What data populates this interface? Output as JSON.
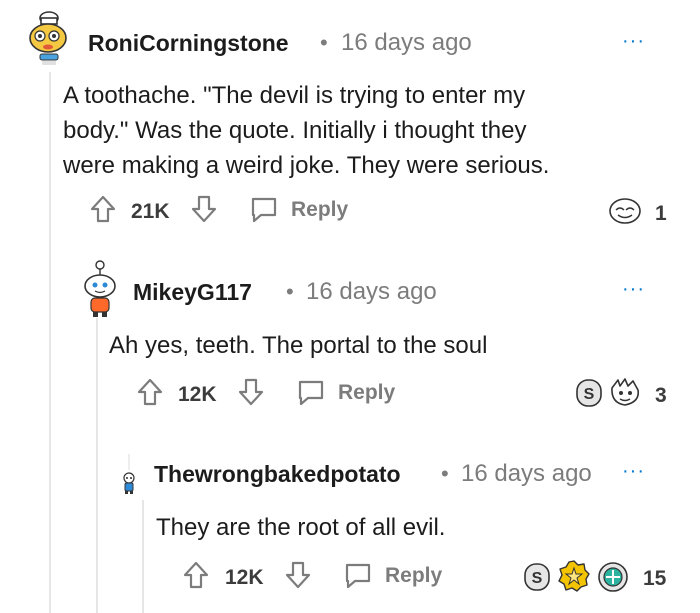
{
  "comments": [
    {
      "username": "RoniCorningstone",
      "separator": "•",
      "time": "16 days ago",
      "more": "···",
      "body_lines": [
        "A toothache. \"The devil is trying to enter my",
        "body.\" Was the quote. Initially i thought they",
        "were making a weird joke. They were serious."
      ],
      "votes": "21K",
      "reply_label": "Reply",
      "award_count": "1"
    },
    {
      "username": "MikeyG117",
      "separator": "•",
      "time": "16 days ago",
      "more": "···",
      "body_lines": [
        "Ah yes, teeth. The portal to the soul"
      ],
      "votes": "12K",
      "reply_label": "Reply",
      "award_count": "3"
    },
    {
      "username": "Thewrongbakedpotato",
      "separator": "•",
      "time": "16 days ago",
      "more": "···",
      "body_lines": [
        "They are the root of all evil."
      ],
      "votes": "12K",
      "reply_label": "Reply",
      "award_count": "15"
    }
  ],
  "colors": {
    "link": "#0079d3",
    "meta": "#7c7c7c",
    "thread": "#e6e6e6",
    "award_gold": "#f5c400",
    "award_teal": "#2bb3a0"
  },
  "icons": [
    "upvote-icon",
    "downvote-icon",
    "reply-bubble-icon",
    "award-icon",
    "avatar-icon"
  ]
}
